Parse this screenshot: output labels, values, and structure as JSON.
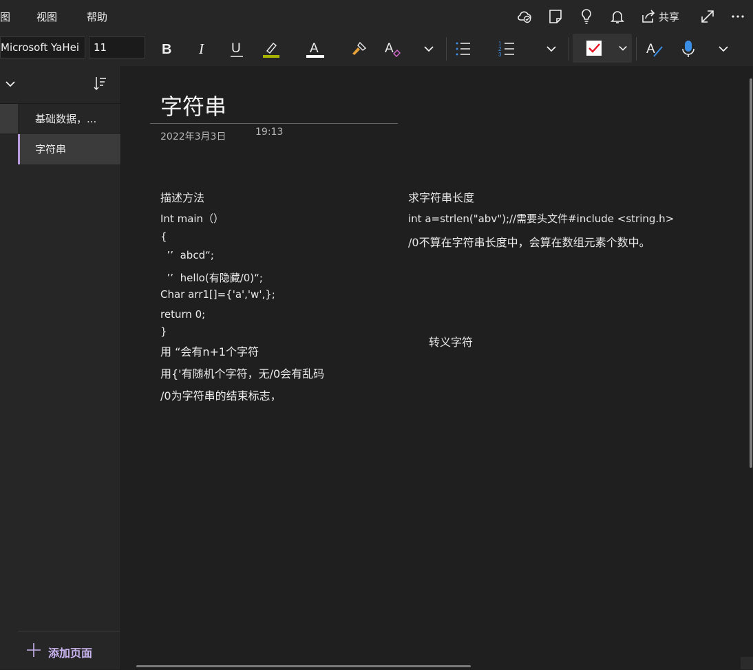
{
  "menu": {
    "items": [
      "图",
      "视图",
      "帮助"
    ],
    "share_label": "共享"
  },
  "toolbar": {
    "font_name": "Microsoft YaHei",
    "font_size": "11",
    "highlight_color": "#a7b300",
    "font_color": "#ffffff",
    "todo_check_color": "#e81123",
    "mic_color": "#3a8ee6",
    "icons": [
      "bold-icon",
      "italic-icon",
      "underline-icon",
      "highlighter-icon",
      "font-color-icon",
      "format-painter-icon",
      "clear-format-icon",
      "bullets-icon",
      "numbering-icon",
      "todo-tag-icon",
      "spell-check-icon",
      "dictate-icon"
    ]
  },
  "pages": [
    {
      "label": "基础数据，..."
    },
    {
      "label": "字符串"
    }
  ],
  "add_page_label": "添加页面",
  "note": {
    "title": "字符串",
    "date": "2022年3月3日",
    "time": "19:13",
    "left_block": [
      "描述方法",
      "Int main（）",
      "{",
      "  ’’  abcd“;",
      "  ’’  hello(有隐藏/0)“;",
      "Char arr1[]={'a','w',};",
      "return 0;",
      "}",
      "用 “会有n+1个字符",
      "用{'有随机个字符，无/0会有乱码",
      "/0为字符串的结束标志，"
    ],
    "right_block": [
      "求字符串长度",
      "int  a=strlen(\"abv\");//需要头文件#include <string.h>",
      "/0不算在字符串长度中，会算在数组元素个数中。"
    ],
    "escape_label": "转义字符"
  },
  "accent_color": "#b89cde"
}
